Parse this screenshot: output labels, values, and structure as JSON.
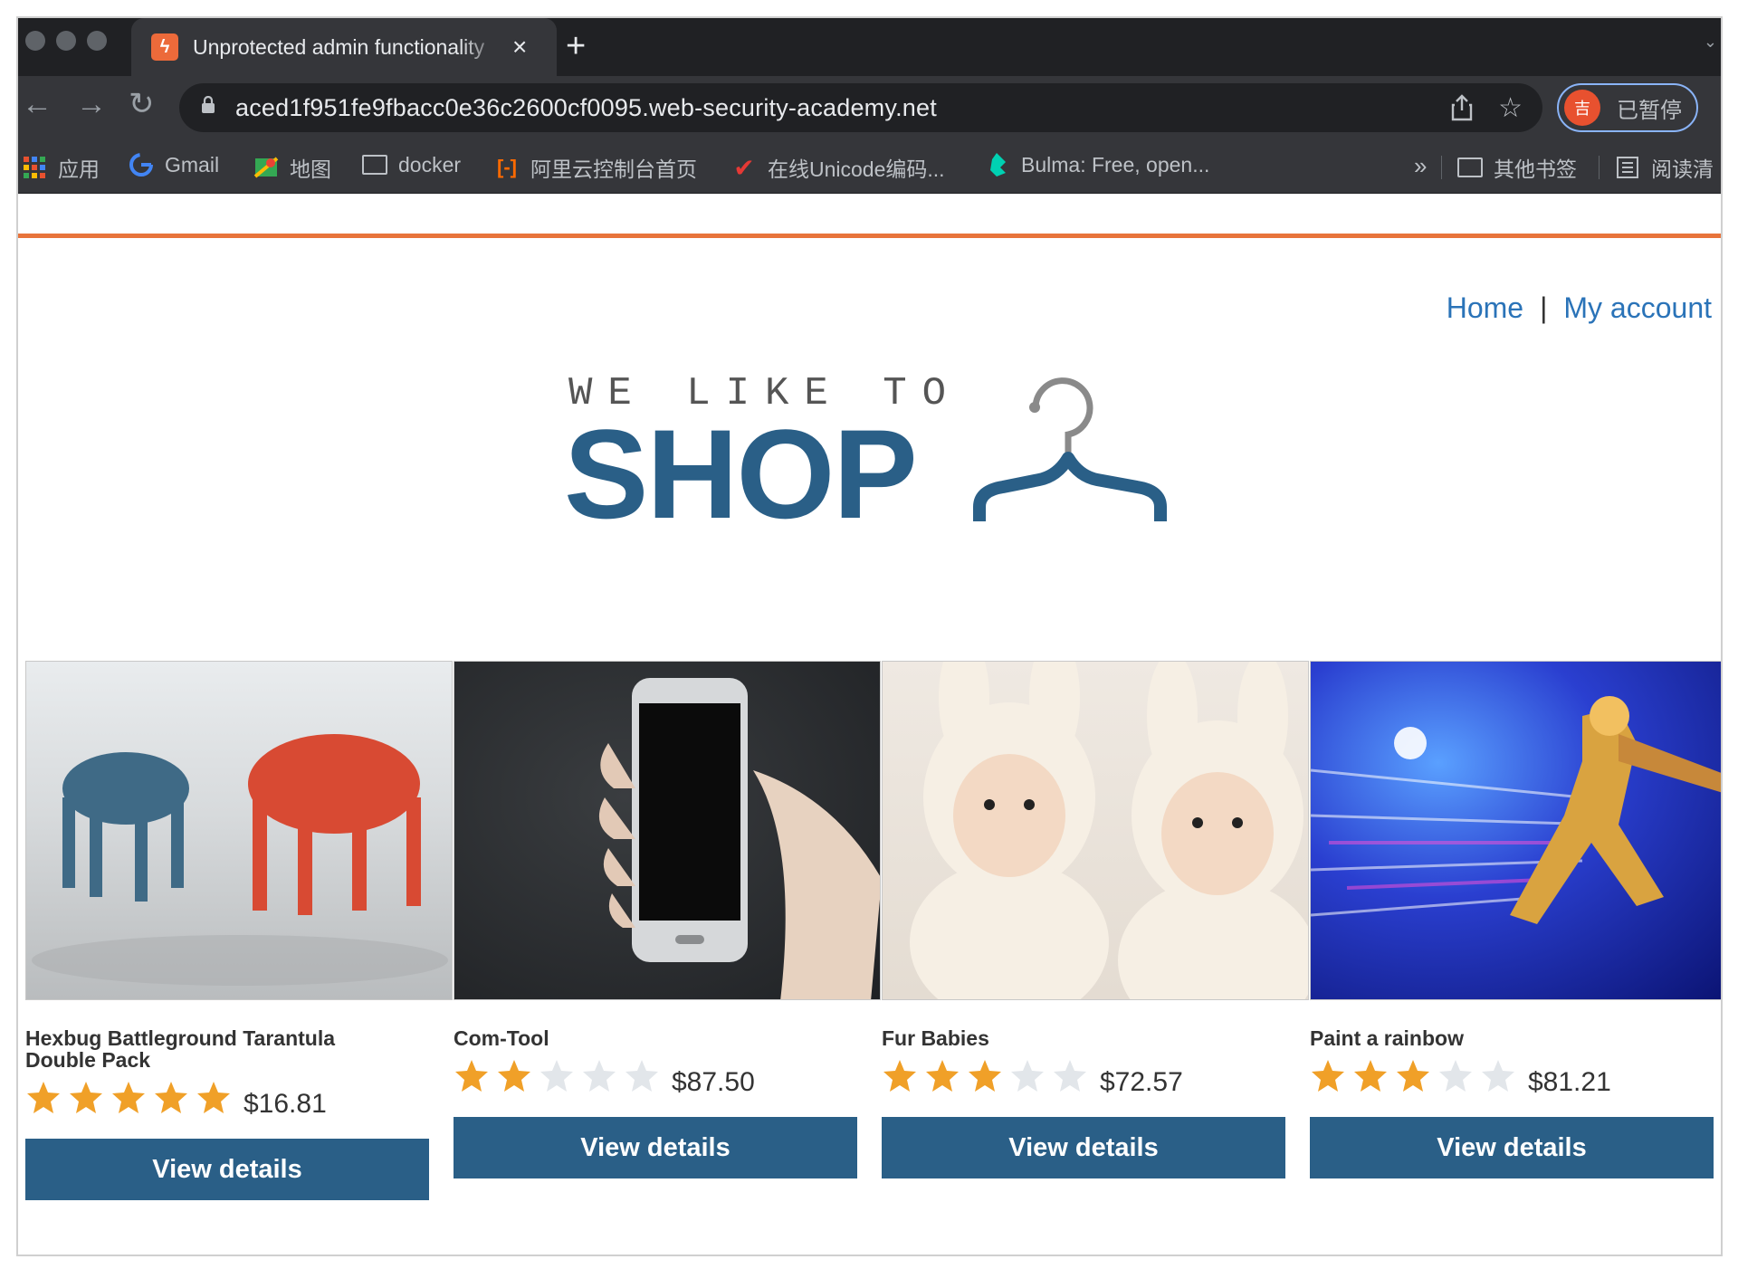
{
  "browser": {
    "tab": {
      "title": "Unprotected admin functionality",
      "favicon": "portswigger-favicon-icon"
    },
    "url": "aced1f951fe9fbacc0e36c2600cf0095.web-security-academy.net",
    "profile": {
      "avatar": "吉",
      "label": "已暂停"
    },
    "bookmarks": [
      {
        "label": "应用",
        "icon": "apps-grid-icon"
      },
      {
        "label": "Gmail",
        "icon": "google-icon"
      },
      {
        "label": "地图",
        "icon": "maps-icon"
      },
      {
        "label": "docker",
        "icon": "folder-icon"
      },
      {
        "label": "阿里云控制台首页",
        "icon": "aliyun-icon"
      },
      {
        "label": "在线Unicode编码...",
        "icon": "checkmark-icon"
      },
      {
        "label": "Bulma: Free, open...",
        "icon": "bulma-icon"
      }
    ],
    "overflow": "»",
    "other_bookmarks": "其他书签",
    "reading_list": "阅读清"
  },
  "nav": {
    "home": "Home",
    "separator": "|",
    "account": "My account"
  },
  "logo": {
    "tagline": "WE LIKE TO",
    "word": "SHOP"
  },
  "products": [
    {
      "name": "Hexbug Battleground Tarantula Double Pack",
      "rating": 5,
      "price": "$16.81",
      "button": "View details",
      "image": "robot-tarantulas-image"
    },
    {
      "name": "Com-Tool",
      "rating": 2,
      "price": "$87.50",
      "button": "View details",
      "image": "smartphone-in-hand-image"
    },
    {
      "name": "Fur Babies",
      "rating": 3,
      "price": "$72.57",
      "button": "View details",
      "image": "babies-in-bunny-hoods-image"
    },
    {
      "name": "Paint a rainbow",
      "rating": 3,
      "price": "$81.21",
      "button": "View details",
      "image": "neon-superhero-image"
    }
  ],
  "colors": {
    "accent": "#e8743b",
    "brand": "#2a5f87",
    "star_on": "#f0a028",
    "star_off": "#e2e6ea"
  }
}
